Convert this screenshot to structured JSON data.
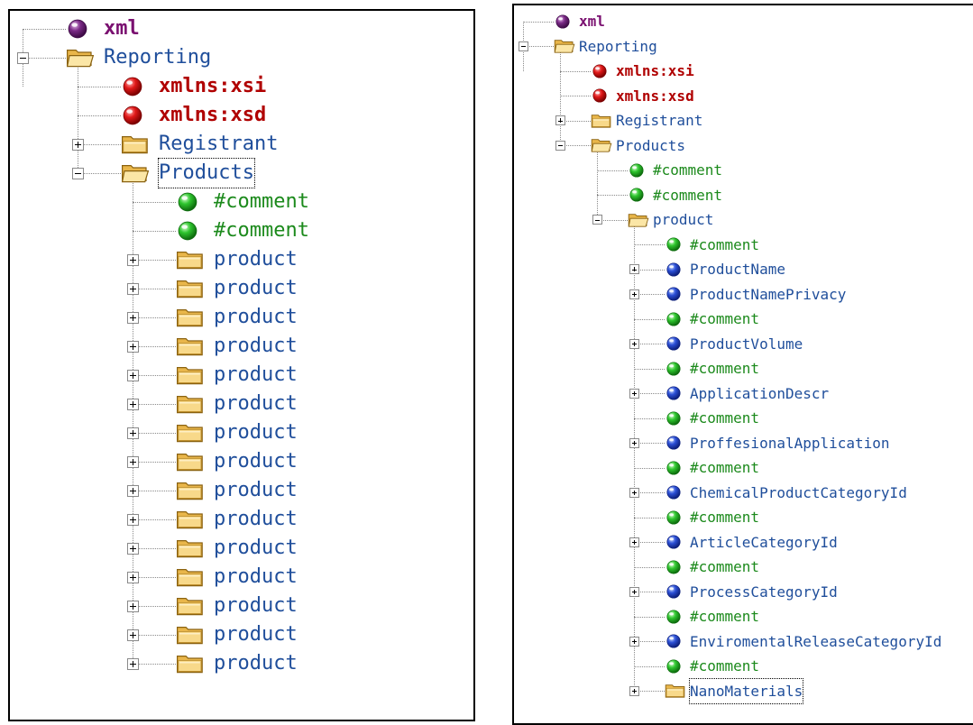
{
  "colors": {
    "element": "#1f4e9b",
    "attribute": "#b00000",
    "comment": "#1c8a1c",
    "declaration": "#7a1070",
    "connector": "#8a8a8a"
  },
  "left_tree": {
    "nodes": [
      {
        "depth": 0,
        "kind": "declaration",
        "icon": "purple-ball-icon",
        "label": "xml",
        "toggle": "none",
        "last": false
      },
      {
        "depth": 0,
        "kind": "element",
        "icon": "open-folder-icon",
        "label": "Reporting",
        "toggle": "minus",
        "last": false
      },
      {
        "depth": 1,
        "kind": "attribute",
        "icon": "red-ball-icon",
        "label": "xmlns:xsi",
        "toggle": "none",
        "last": false
      },
      {
        "depth": 1,
        "kind": "attribute",
        "icon": "red-ball-icon",
        "label": "xmlns:xsd",
        "toggle": "none",
        "last": false
      },
      {
        "depth": 1,
        "kind": "element",
        "icon": "folder-icon",
        "label": "Registrant",
        "toggle": "plus",
        "last": false
      },
      {
        "depth": 1,
        "kind": "element",
        "icon": "open-folder-icon",
        "label": "Products",
        "toggle": "minus",
        "last": false,
        "selected": true
      },
      {
        "depth": 2,
        "kind": "comment",
        "icon": "green-ball-icon",
        "label": "#comment",
        "toggle": "none",
        "last": false
      },
      {
        "depth": 2,
        "kind": "comment",
        "icon": "green-ball-icon",
        "label": "#comment",
        "toggle": "none",
        "last": false
      },
      {
        "depth": 2,
        "kind": "element",
        "icon": "folder-icon",
        "label": "product",
        "toggle": "plus",
        "last": false
      },
      {
        "depth": 2,
        "kind": "element",
        "icon": "folder-icon",
        "label": "product",
        "toggle": "plus",
        "last": false
      },
      {
        "depth": 2,
        "kind": "element",
        "icon": "folder-icon",
        "label": "product",
        "toggle": "plus",
        "last": false
      },
      {
        "depth": 2,
        "kind": "element",
        "icon": "folder-icon",
        "label": "product",
        "toggle": "plus",
        "last": false
      },
      {
        "depth": 2,
        "kind": "element",
        "icon": "folder-icon",
        "label": "product",
        "toggle": "plus",
        "last": false
      },
      {
        "depth": 2,
        "kind": "element",
        "icon": "folder-icon",
        "label": "product",
        "toggle": "plus",
        "last": false
      },
      {
        "depth": 2,
        "kind": "element",
        "icon": "folder-icon",
        "label": "product",
        "toggle": "plus",
        "last": false
      },
      {
        "depth": 2,
        "kind": "element",
        "icon": "folder-icon",
        "label": "product",
        "toggle": "plus",
        "last": false
      },
      {
        "depth": 2,
        "kind": "element",
        "icon": "folder-icon",
        "label": "product",
        "toggle": "plus",
        "last": false
      },
      {
        "depth": 2,
        "kind": "element",
        "icon": "folder-icon",
        "label": "product",
        "toggle": "plus",
        "last": false
      },
      {
        "depth": 2,
        "kind": "element",
        "icon": "folder-icon",
        "label": "product",
        "toggle": "plus",
        "last": false
      },
      {
        "depth": 2,
        "kind": "element",
        "icon": "folder-icon",
        "label": "product",
        "toggle": "plus",
        "last": false
      },
      {
        "depth": 2,
        "kind": "element",
        "icon": "folder-icon",
        "label": "product",
        "toggle": "plus",
        "last": false
      },
      {
        "depth": 2,
        "kind": "element",
        "icon": "folder-icon",
        "label": "product",
        "toggle": "plus",
        "last": false
      },
      {
        "depth": 2,
        "kind": "element",
        "icon": "folder-icon",
        "label": "product",
        "toggle": "plus",
        "last": true
      }
    ]
  },
  "right_tree": {
    "nodes": [
      {
        "depth": 0,
        "kind": "declaration",
        "icon": "purple-ball-icon",
        "label": "xml",
        "toggle": "none",
        "last": false
      },
      {
        "depth": 0,
        "kind": "element",
        "icon": "open-folder-icon",
        "label": "Reporting",
        "toggle": "minus",
        "last": false
      },
      {
        "depth": 1,
        "kind": "attribute",
        "icon": "red-ball-icon",
        "label": "xmlns:xsi",
        "toggle": "none",
        "last": false
      },
      {
        "depth": 1,
        "kind": "attribute",
        "icon": "red-ball-icon",
        "label": "xmlns:xsd",
        "toggle": "none",
        "last": false
      },
      {
        "depth": 1,
        "kind": "element",
        "icon": "folder-icon",
        "label": "Registrant",
        "toggle": "plus",
        "last": false
      },
      {
        "depth": 1,
        "kind": "element",
        "icon": "open-folder-icon",
        "label": "Products",
        "toggle": "minus",
        "last": false
      },
      {
        "depth": 2,
        "kind": "comment",
        "icon": "green-ball-icon",
        "label": "#comment",
        "toggle": "none",
        "last": false
      },
      {
        "depth": 2,
        "kind": "comment",
        "icon": "green-ball-icon",
        "label": "#comment",
        "toggle": "none",
        "last": false
      },
      {
        "depth": 2,
        "kind": "element",
        "icon": "open-folder-icon",
        "label": "product",
        "toggle": "minus",
        "last": false
      },
      {
        "depth": 3,
        "kind": "comment",
        "icon": "green-ball-icon",
        "label": "#comment",
        "toggle": "none",
        "last": false
      },
      {
        "depth": 3,
        "kind": "field",
        "icon": "blue-ball-icon",
        "label": "ProductName",
        "toggle": "plus",
        "last": false
      },
      {
        "depth": 3,
        "kind": "field",
        "icon": "blue-ball-icon",
        "label": "ProductNamePrivacy",
        "toggle": "plus",
        "last": false
      },
      {
        "depth": 3,
        "kind": "comment",
        "icon": "green-ball-icon",
        "label": "#comment",
        "toggle": "none",
        "last": false
      },
      {
        "depth": 3,
        "kind": "field",
        "icon": "blue-ball-icon",
        "label": "ProductVolume",
        "toggle": "plus",
        "last": false
      },
      {
        "depth": 3,
        "kind": "comment",
        "icon": "green-ball-icon",
        "label": "#comment",
        "toggle": "none",
        "last": false
      },
      {
        "depth": 3,
        "kind": "field",
        "icon": "blue-ball-icon",
        "label": "ApplicationDescr",
        "toggle": "plus",
        "last": false
      },
      {
        "depth": 3,
        "kind": "comment",
        "icon": "green-ball-icon",
        "label": "#comment",
        "toggle": "none",
        "last": false
      },
      {
        "depth": 3,
        "kind": "field",
        "icon": "blue-ball-icon",
        "label": "ProffesionalApplication",
        "toggle": "plus",
        "last": false
      },
      {
        "depth": 3,
        "kind": "comment",
        "icon": "green-ball-icon",
        "label": "#comment",
        "toggle": "none",
        "last": false
      },
      {
        "depth": 3,
        "kind": "field",
        "icon": "blue-ball-icon",
        "label": "ChemicalProductCategoryId",
        "toggle": "plus",
        "last": false
      },
      {
        "depth": 3,
        "kind": "comment",
        "icon": "green-ball-icon",
        "label": "#comment",
        "toggle": "none",
        "last": false
      },
      {
        "depth": 3,
        "kind": "field",
        "icon": "blue-ball-icon",
        "label": "ArticleCategoryId",
        "toggle": "plus",
        "last": false
      },
      {
        "depth": 3,
        "kind": "comment",
        "icon": "green-ball-icon",
        "label": "#comment",
        "toggle": "none",
        "last": false
      },
      {
        "depth": 3,
        "kind": "field",
        "icon": "blue-ball-icon",
        "label": "ProcessCategoryId",
        "toggle": "plus",
        "last": false
      },
      {
        "depth": 3,
        "kind": "comment",
        "icon": "green-ball-icon",
        "label": "#comment",
        "toggle": "none",
        "last": false
      },
      {
        "depth": 3,
        "kind": "field",
        "icon": "blue-ball-icon",
        "label": "EnviromentalReleaseCategoryId",
        "toggle": "plus",
        "last": false
      },
      {
        "depth": 3,
        "kind": "comment",
        "icon": "green-ball-icon",
        "label": "#comment",
        "toggle": "none",
        "last": false
      },
      {
        "depth": 3,
        "kind": "element",
        "icon": "folder-icon",
        "label": "NanoMaterials",
        "toggle": "plus",
        "last": false,
        "selected": true
      }
    ]
  }
}
